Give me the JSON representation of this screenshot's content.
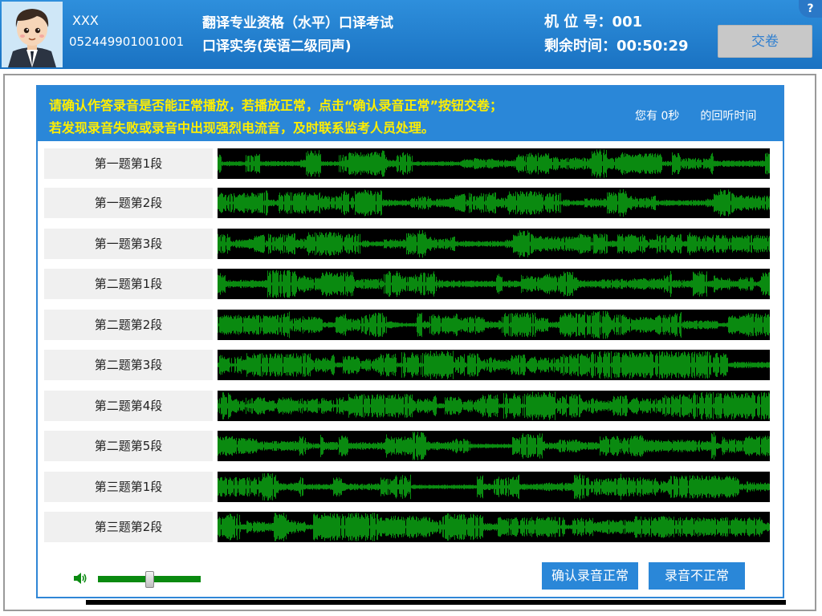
{
  "header": {
    "candidate_name": "XXX",
    "candidate_id": "052449901001001",
    "exam_title": "翻译专业资格（水平）口译考试",
    "exam_subtitle": "口译实务(英语二级同声)",
    "seat_label": "机 位 号：",
    "seat_value": "001",
    "time_label": "剩余时间：",
    "time_value": "00:50:29",
    "submit_label": "交卷",
    "help_label": "?"
  },
  "notice": {
    "line1": "请确认作答录音是否能正常播放，若播放正常，点击“确认录音正常”按钮交卷；",
    "line2": "若发现录音失败或录音中出现强烈电流音，及时联系监考人员处理。",
    "replay_prefix": "您有",
    "replay_value": "0秒",
    "replay_suffix": "的回听时间"
  },
  "segments": [
    {
      "label": "第一题第1段"
    },
    {
      "label": "第一题第2段"
    },
    {
      "label": "第一题第3段"
    },
    {
      "label": "第二题第1段"
    },
    {
      "label": "第二题第2段"
    },
    {
      "label": "第二题第3段"
    },
    {
      "label": "第二题第4段"
    },
    {
      "label": "第二题第5段"
    },
    {
      "label": "第三题第1段"
    },
    {
      "label": "第三题第2段"
    }
  ],
  "controls": {
    "volume_level": 0.5,
    "confirm_label": "确认录音正常",
    "abnormal_label": "录音不正常"
  },
  "colors": {
    "header_blue": "#1a72c2",
    "notice_yellow": "#ffee00",
    "waveform_green": "#0a8a10",
    "button_blue": "#2a87d8"
  }
}
